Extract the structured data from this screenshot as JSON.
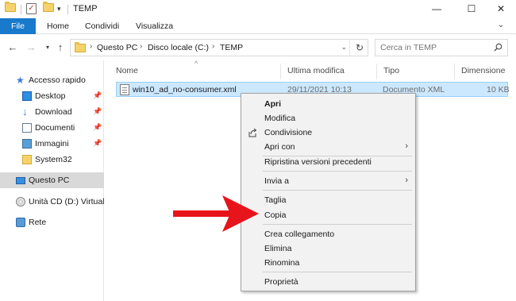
{
  "window": {
    "title": "TEMP",
    "controls": {
      "minimize": "—",
      "maximize": "☐",
      "close": "✕"
    }
  },
  "ribbon": {
    "tabs": [
      {
        "label": "File"
      },
      {
        "label": "Home"
      },
      {
        "label": "Condividi"
      },
      {
        "label": "Visualizza"
      }
    ],
    "expand_icon": "chevron-down-icon"
  },
  "address": {
    "crumbs": [
      "Questo PC",
      "Disco locale (C:)",
      "TEMP"
    ]
  },
  "search": {
    "placeholder": "Cerca in TEMP"
  },
  "navpane": {
    "items": [
      {
        "label": "Accesso rapido",
        "icon": "star-icon",
        "pinned": false
      },
      {
        "label": "Desktop",
        "icon": "desktop-icon",
        "pinned": true
      },
      {
        "label": "Download",
        "icon": "download-icon",
        "pinned": true
      },
      {
        "label": "Documenti",
        "icon": "documents-icon",
        "pinned": true
      },
      {
        "label": "Immagini",
        "icon": "pictures-icon",
        "pinned": true
      },
      {
        "label": "System32",
        "icon": "folder-icon",
        "pinned": false
      },
      {
        "label": "Questo PC",
        "icon": "computer-icon",
        "pinned": false,
        "selected": true
      },
      {
        "label": "Unità CD (D:) VirtualB",
        "icon": "cd-drive-icon",
        "pinned": false
      },
      {
        "label": "Rete",
        "icon": "network-icon",
        "pinned": false
      }
    ]
  },
  "columns": [
    "Nome",
    "Ultima modifica",
    "Tipo",
    "Dimensione"
  ],
  "files": [
    {
      "name": "win10_ad_no-consumer.xml",
      "modified": "29/11/2021 10:13",
      "type": "Documento XML",
      "size": "10 KB",
      "selected": true
    }
  ],
  "context_menu": {
    "items": [
      {
        "label": "Apri",
        "bold": true
      },
      {
        "label": "Modifica"
      },
      {
        "label": "Condivisione",
        "icon": "share-icon"
      },
      {
        "label": "Apri con",
        "submenu": true
      },
      {
        "label": "Ripristina versioni precedenti"
      },
      {
        "label": "Invia a",
        "submenu": true
      },
      {
        "label": "Taglia"
      },
      {
        "label": "Copia",
        "highlighted_by_arrow": true
      },
      {
        "label": "Crea collegamento"
      },
      {
        "label": "Elimina"
      },
      {
        "label": "Rinomina"
      },
      {
        "label": "Proprietà"
      }
    ]
  },
  "annotation": {
    "arrow_color": "#e8141b",
    "points_to": "Copia"
  },
  "colors": {
    "file_tab": "#1979ca",
    "selection": "#cce8ff",
    "selection_border": "#99d1ff",
    "menu_bg": "#f2f2f2"
  }
}
